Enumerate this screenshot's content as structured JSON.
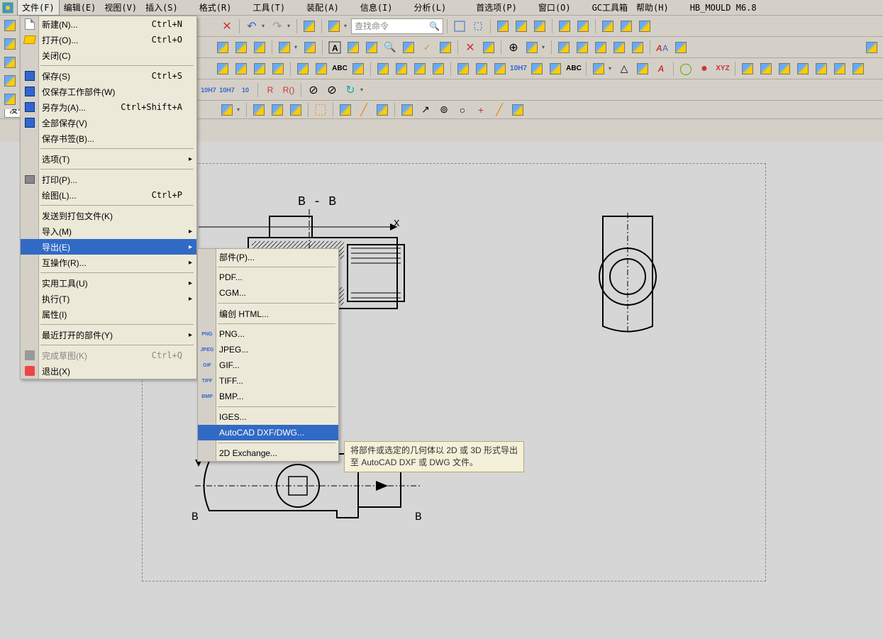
{
  "menubar": {
    "items": [
      {
        "label": "文件(F)",
        "active": true
      },
      {
        "label": "编辑(E)"
      },
      {
        "label": "视图(V)"
      },
      {
        "label": "插入(S)"
      },
      {
        "label": "格式(R)"
      },
      {
        "label": "工具(T)"
      },
      {
        "label": "装配(A)"
      },
      {
        "label": "信息(I)"
      },
      {
        "label": "分析(L)"
      },
      {
        "label": "首选项(P)"
      },
      {
        "label": "窗口(O)"
      },
      {
        "label": "GC工具箱"
      },
      {
        "label": "帮助(H)"
      },
      {
        "label": "HB_MOULD M6.8"
      }
    ]
  },
  "search": {
    "placeholder": "查找命令"
  },
  "toolbar_dropdown": {
    "text": "没有"
  },
  "file_menu": {
    "items": [
      {
        "label": "新建(N)...",
        "shortcut": "Ctrl+N",
        "icon": "new"
      },
      {
        "label": "打开(O)...",
        "shortcut": "Ctrl+O",
        "icon": "open"
      },
      {
        "label": "关闭(C)"
      },
      {
        "div": true
      },
      {
        "label": "保存(S)",
        "shortcut": "Ctrl+S",
        "icon": "save"
      },
      {
        "label": "仅保存工作部件(W)"
      },
      {
        "label": "另存为(A)...",
        "shortcut": "Ctrl+Shift+A"
      },
      {
        "label": "全部保存(V)"
      },
      {
        "label": "保存书签(B)..."
      },
      {
        "div": true
      },
      {
        "label": "选项(T)",
        "submenu": true
      },
      {
        "div": true
      },
      {
        "label": "打印(P)...",
        "icon": "print"
      },
      {
        "label": "绘图(L)...",
        "shortcut": "Ctrl+P"
      },
      {
        "div": true
      },
      {
        "label": "发送到打包文件(K)"
      },
      {
        "label": "导入(M)",
        "submenu": true
      },
      {
        "label": "导出(E)",
        "submenu": true,
        "highlighted": true
      },
      {
        "label": "互操作(R)...",
        "submenu": true
      },
      {
        "div": true
      },
      {
        "label": "实用工具(U)",
        "submenu": true
      },
      {
        "label": "执行(T)",
        "submenu": true
      },
      {
        "label": "属性(I)"
      },
      {
        "div": true
      },
      {
        "label": "最近打开的部件(Y)",
        "submenu": true
      },
      {
        "div": true
      },
      {
        "label": "完成草图(K)",
        "shortcut": "Ctrl+Q",
        "disabled": true
      },
      {
        "label": "退出(X)",
        "icon": "exit"
      }
    ]
  },
  "export_menu": {
    "items": [
      {
        "label": "部件(P)..."
      },
      {
        "div": true
      },
      {
        "label": "PDF..."
      },
      {
        "label": "CGM..."
      },
      {
        "div": true
      },
      {
        "label": "编创 HTML..."
      },
      {
        "div": true
      },
      {
        "label": "PNG...",
        "badge": "PNG"
      },
      {
        "label": "JPEG...",
        "badge": "JPEG"
      },
      {
        "label": "GIF...",
        "badge": "GIF"
      },
      {
        "label": "TIFF...",
        "badge": "TIFF"
      },
      {
        "label": "BMP...",
        "badge": "BMP"
      },
      {
        "div": true
      },
      {
        "label": "IGES..."
      },
      {
        "label": "AutoCAD DXF/DWG...",
        "highlighted": true
      },
      {
        "div": true
      },
      {
        "label": "2D Exchange..."
      }
    ]
  },
  "tooltip": {
    "line1": "将部件或选定的几何体以 2D 或 3D 形式导出",
    "line2": "至 AutoCAD DXF 或 DWG 文件。"
  },
  "drawing": {
    "section_label": "B - B",
    "axis_x": "X",
    "marker_left": "B",
    "marker_right": "B"
  },
  "icons": {
    "undo": "↶",
    "redo": "↷",
    "search": "🔍"
  }
}
